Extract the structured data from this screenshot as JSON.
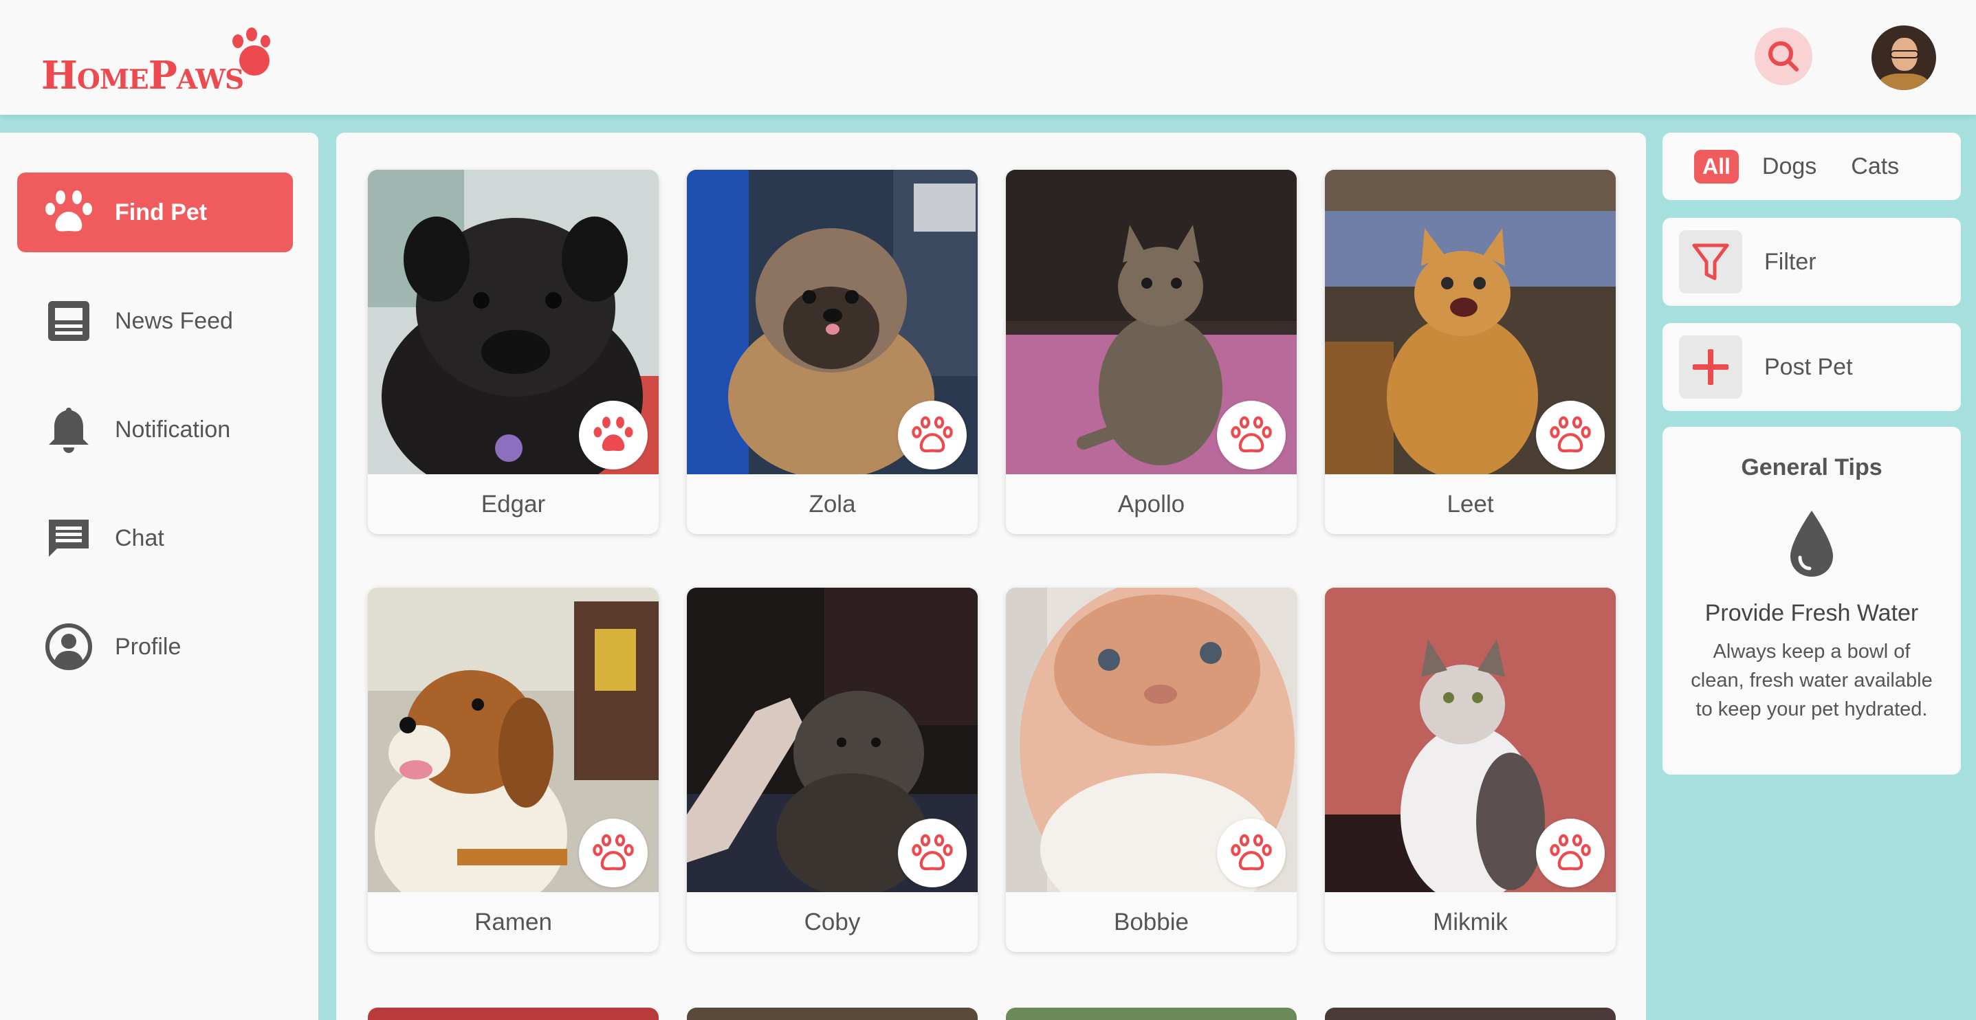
{
  "app": {
    "logo_text": "HomePaws",
    "brand_color": "#ec4a4f",
    "background_color": "#a5e0df"
  },
  "header": {
    "search_icon": "search-icon",
    "avatar_icon": "user-avatar"
  },
  "sidebar": {
    "items": [
      {
        "label": "Find Pet",
        "icon": "paw-icon",
        "active": true
      },
      {
        "label": "News Feed",
        "icon": "newspaper-icon",
        "active": false
      },
      {
        "label": "Notification",
        "icon": "bell-icon",
        "active": false
      },
      {
        "label": "Chat",
        "icon": "chat-icon",
        "active": false
      },
      {
        "label": "Profile",
        "icon": "user-circle-icon",
        "active": false
      }
    ]
  },
  "pets": [
    {
      "name": "Edgar",
      "paw_filled": true
    },
    {
      "name": "Zola",
      "paw_filled": false
    },
    {
      "name": "Apollo",
      "paw_filled": false
    },
    {
      "name": "Leet",
      "paw_filled": false
    },
    {
      "name": "Ramen",
      "paw_filled": false
    },
    {
      "name": "Coby",
      "paw_filled": false
    },
    {
      "name": "Bobbie",
      "paw_filled": false
    },
    {
      "name": "Mikmik",
      "paw_filled": false
    }
  ],
  "filters": {
    "tabs": [
      "All",
      "Dogs",
      "Cats"
    ],
    "active_tab": "All"
  },
  "actions": {
    "filter_label": "Filter",
    "post_label": "Post Pet"
  },
  "tips": {
    "title": "General Tips",
    "icon": "water-drop-icon",
    "heading": "Provide Fresh Water",
    "body": "Always keep a bowl of clean, fresh water available to keep your pet hydrated."
  }
}
